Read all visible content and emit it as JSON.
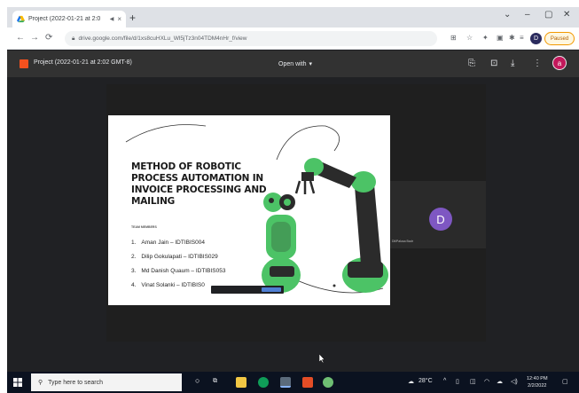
{
  "browser": {
    "tab_title": "Project (2022-01-21 at 2:0",
    "tab_close": "×",
    "new_tab": "+",
    "url": "drive.google.com/file/d/1xs8cuHXLu_Wl5jTz3n04TDM4nHr_f/view",
    "paused_label": "Paused",
    "profile_initial": "D",
    "window_controls": [
      "⌄",
      "–",
      "▢",
      "✕"
    ]
  },
  "viewer": {
    "file_name": "Project (2022-01-21 at 2:02 GMT-8)",
    "open_with": "Open with",
    "avatar_initial": "a"
  },
  "slide": {
    "title": "METHOD OF ROBOTIC PROCESS AUTOMATION IN INVOICE PROCESSING AND MAILING",
    "team_label": "TEAM MEMBERS",
    "members": [
      {
        "num": "1.",
        "text": "Aman Jain – IDTIBIS004"
      },
      {
        "num": "2.",
        "text": "Dilip Gokulapati – IDTIBIS029"
      },
      {
        "num": "3.",
        "text": "Md Danish Quaum – IDTIBIS053"
      },
      {
        "num": "4.",
        "text": "Vinat Solanki – IDTIBIS0"
      }
    ]
  },
  "participant": {
    "initial": "D",
    "name": "DiliPalusa Badr"
  },
  "taskbar": {
    "search_placeholder": "Type here to search",
    "weather": "28°C",
    "time": "12:40 PM",
    "date": "2/2/2022"
  },
  "colors": {
    "robot_green": "#4cc366",
    "robot_dark": "#2b2b2b",
    "participant_purple": "#7e57c2"
  }
}
